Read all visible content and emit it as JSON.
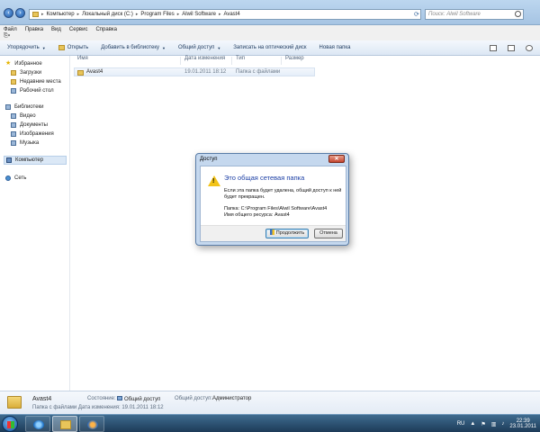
{
  "address": {
    "crumbs": [
      "Компьютер",
      "Локальный диск (C:)",
      "Program Files",
      "Alwil Software",
      "Avast4"
    ],
    "search_placeholder": "Поиск: Alwil Software"
  },
  "menu": [
    "Файл",
    "Правка",
    "Вид",
    "Сервис",
    "Справка"
  ],
  "toolbar": {
    "organize": "Упорядочить",
    "open": "Открыть",
    "add_library": "Добавить в библиотеку",
    "share": "Общий доступ",
    "burn": "Записать на оптический диск",
    "new_folder": "Новая папка"
  },
  "sidebar": {
    "favorites": "Избранное",
    "downloads": "Загрузки",
    "recent": "Недавние места",
    "desktop": "Рабочий стол",
    "libraries": "Библиотеки",
    "video": "Видео",
    "documents": "Документы",
    "images": "Изображения",
    "music": "Музыка",
    "computer": "Компьютер",
    "network": "Сеть"
  },
  "columns": {
    "name": "Имя",
    "date": "Дата изменения",
    "type": "Тип",
    "size": "Размер"
  },
  "file": {
    "name": "Avast4",
    "date": "19.01.2011 18:12",
    "type": "Папка с файлами"
  },
  "dialog": {
    "title": "Доступ",
    "heading": "Это общая сетевая папка",
    "message": "Если эта папка будет удалена, общий доступ к ней будет прекращен.",
    "folder_label": "Папка:",
    "folder_path": "C:\\Program Files\\Alwil Software\\Avast4",
    "share_label": "Имя общего ресурса:",
    "share_name": "Avast4",
    "continue": "Продолжить",
    "cancel": "Отмена"
  },
  "details": {
    "name": "Avast4",
    "status_label": "Состояние:",
    "status_value": "Общий доступ",
    "shared_label": "Общий доступ:",
    "shared_value": "Администратор",
    "type_line": "Папка с файлами Дата изменения: 19.01.2011 18:12"
  },
  "taskbar": {
    "lang": "RU",
    "time": "22:39",
    "date": "23.01.2011"
  }
}
